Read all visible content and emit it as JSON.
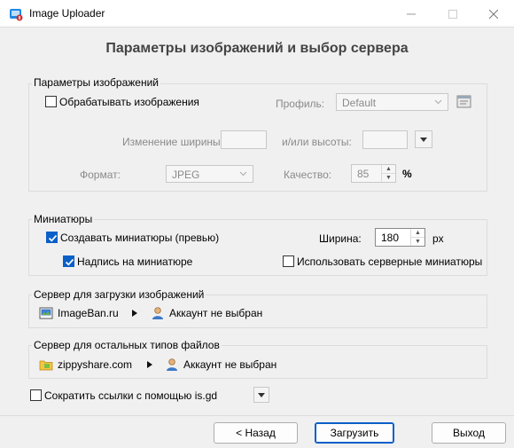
{
  "window": {
    "title": "Image Uploader"
  },
  "header": {
    "title": "Параметры изображений и выбор сервера"
  },
  "image_params": {
    "group_title": "Параметры изображений",
    "process_label": "Обрабатывать изображения",
    "profile_label": "Профиль:",
    "profile_value": "Default",
    "width_change_label": "Изменение ширины:",
    "width_value": "",
    "height_label": "и/или высоты:",
    "height_value": "",
    "format_label": "Формат:",
    "format_value": "JPEG",
    "quality_label": "Качество:",
    "quality_value": "85",
    "quality_unit": "%"
  },
  "thumbnails": {
    "group_title": "Миниатюры",
    "create_label": "Создавать миниатюры (превью)",
    "width_label": "Ширина:",
    "width_value": "180",
    "width_unit": "px",
    "caption_label": "Надпись на миниатюре",
    "server_thumbs_label": "Использовать серверные миниатюры"
  },
  "image_server": {
    "group_title": "Сервер для загрузки изображений",
    "server_name": "ImageBan.ru",
    "account": "Аккаунт не выбран"
  },
  "file_server": {
    "group_title": "Сервер для остальных типов файлов",
    "server_name": "zippyshare.com",
    "account": "Аккаунт не выбран"
  },
  "shorten": {
    "label": "Сократить ссылки с помощью is.gd"
  },
  "buttons": {
    "back": "< Назад",
    "upload": "Загрузить",
    "exit": "Выход"
  },
  "colors": {
    "accent": "#0a5fc8",
    "disabled_text": "#8a8a8a"
  }
}
